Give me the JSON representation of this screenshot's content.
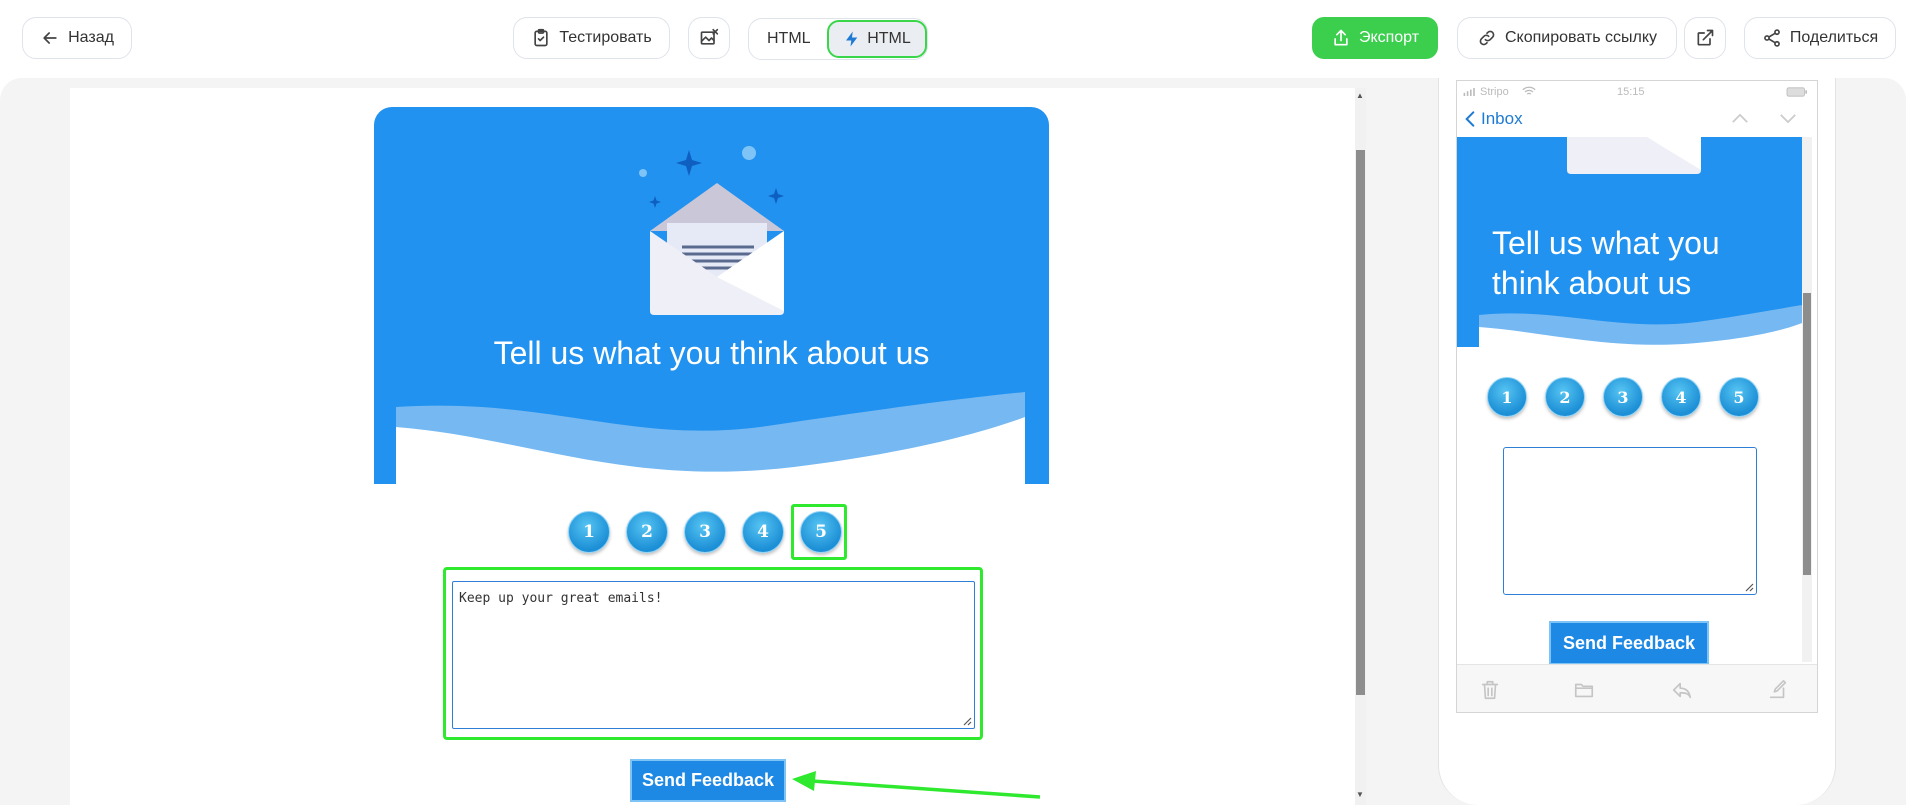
{
  "toolbar": {
    "back_label": "Назад",
    "test_label": "Тестировать",
    "html_label": "HTML",
    "amp_html_label": "HTML",
    "export_label": "Экспорт",
    "copy_link_label": "Скопировать ссылку",
    "share_label": "Поделиться"
  },
  "email": {
    "title": "Tell us what you think about us",
    "ratings": [
      "1",
      "2",
      "3",
      "4",
      "5"
    ],
    "selected_rating": "5",
    "feedback_text": "Keep up your great emails!",
    "send_label": "Send Feedback"
  },
  "mobile": {
    "carrier": "Stripo",
    "time": "15:15",
    "back_label": "Inbox",
    "title": "Tell us what you think about us",
    "ratings": [
      "1",
      "2",
      "3",
      "4",
      "5"
    ],
    "send_label": "Send Feedback"
  },
  "colors": {
    "accent_green": "#3ccf4e",
    "email_blue": "#2192ef",
    "highlight": "#2fe92f"
  }
}
